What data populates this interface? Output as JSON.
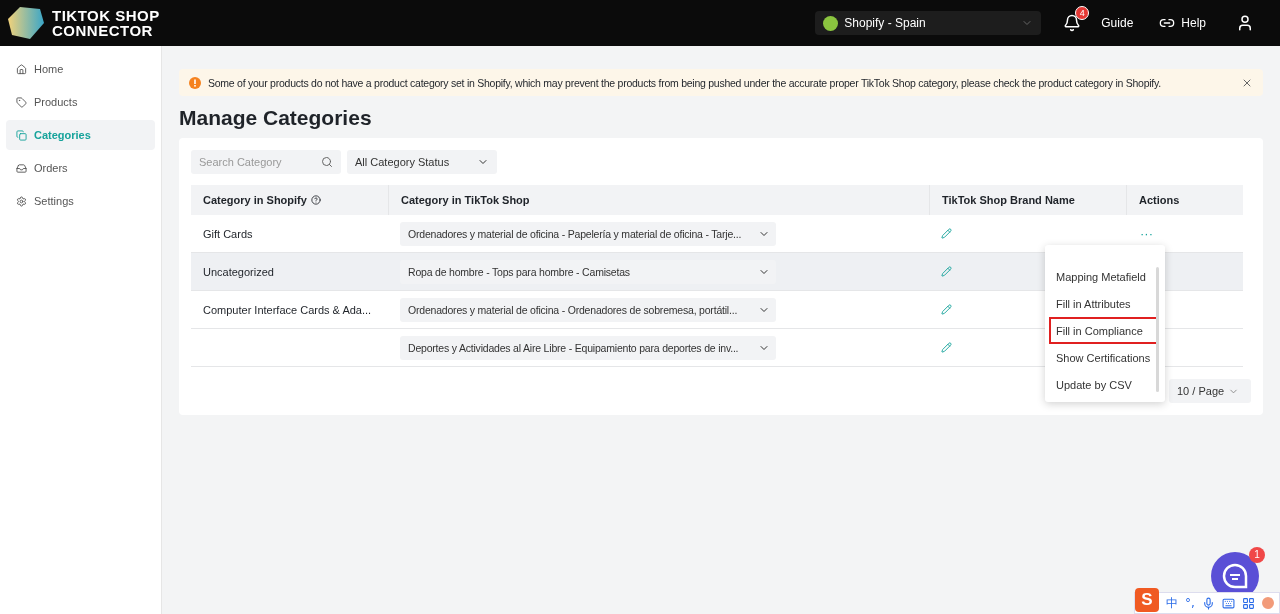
{
  "header": {
    "logo": {
      "line1": "TIKTOK SHOP",
      "line2": "CONNECTOR"
    },
    "store_selector": "Shopify - Spain",
    "notifications": {
      "count": "4"
    },
    "links": [
      {
        "kind": "guide",
        "label": "Guide"
      },
      {
        "kind": "help",
        "label": "Help"
      }
    ]
  },
  "sidebar": {
    "items": [
      {
        "label": "Home",
        "selected": false
      },
      {
        "label": "Products",
        "selected": false
      },
      {
        "label": "Categories",
        "selected": true
      },
      {
        "label": "Orders",
        "selected": false
      },
      {
        "label": "Settings",
        "selected": false
      }
    ]
  },
  "alert": {
    "text": "Some of your products do not have a product category set in Shopify, which may prevent the products from being pushed under the accurate proper TikTok Shop category, please check the product category in Shopify."
  },
  "page_title": "Manage Categories",
  "filters": {
    "search": {
      "placeholder": "Search Category"
    },
    "status": "All Category Status"
  },
  "table": {
    "columns": [
      "Category in Shopify",
      "Category in TikTok Shop",
      "TikTok Shop Brand Name",
      "Actions"
    ],
    "rows": [
      {
        "shopify": "Gift Cards",
        "tiktok": "Ordenadores y material de oficina - Papelería y material de oficina - Tarje...",
        "highlighted": false,
        "actions": "···"
      },
      {
        "shopify": "Uncategorized",
        "tiktok": "Ropa de hombre - Tops para hombre - Camisetas",
        "highlighted": true
      },
      {
        "shopify": "Computer Interface Cards & Ada...",
        "tiktok": "Ordenadores y material de oficina - Ordenadores de sobremesa, portátil...",
        "highlighted": false
      },
      {
        "shopify": "",
        "tiktok": "Deportes y Actividades al Aire Libre - Equipamiento para deportes de inv...",
        "highlighted": false
      }
    ]
  },
  "actions_menu": {
    "items": [
      {
        "label": "Mapping Metafield",
        "highlighted": false
      },
      {
        "label": "Fill in Attributes",
        "highlighted": false
      },
      {
        "label": "Fill in Compliance",
        "highlighted": true
      },
      {
        "label": "Show Certifications",
        "highlighted": false
      },
      {
        "label": "Update by CSV",
        "highlighted": false
      }
    ]
  },
  "pagination": {
    "page_size": "10",
    "page_size_label": "/ Page"
  },
  "chat": {
    "badge": "1"
  },
  "ime_bar": {
    "logo": "S",
    "mode": "中",
    "punctuation": "°,"
  }
}
